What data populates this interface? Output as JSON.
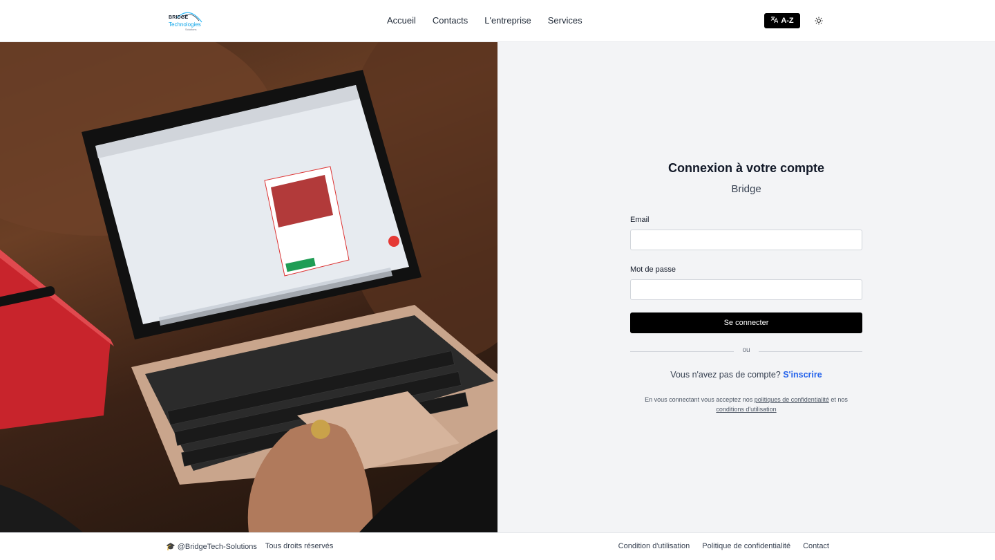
{
  "header": {
    "logo_text": "BRIDGE",
    "logo_sub": "Technologies",
    "logo_tiny": "Solutions",
    "nav": [
      {
        "label": "Accueil"
      },
      {
        "label": "Contacts"
      },
      {
        "label": "L'entreprise"
      },
      {
        "label": "Services"
      }
    ],
    "lang_button": "A-Z",
    "lang_icon": "translate-icon",
    "theme_icon": "sun-icon"
  },
  "hero": {
    "image_icon": "laptop-photo"
  },
  "login": {
    "title": "Connexion à votre compte",
    "subtitle": "Bridge",
    "email_label": "Email",
    "email_value": "",
    "password_label": "Mot de passe",
    "password_value": "",
    "submit_label": "Se connecter",
    "divider_text": "ou",
    "signup_prompt": "Vous n'avez pas de compte?",
    "signup_link": "S'inscrire",
    "legal_prefix": "En vous connectant vous acceptez nos",
    "legal_privacy": "politiques de confidentialité",
    "legal_and": "et nos",
    "legal_terms": "conditions d'utilisation"
  },
  "footer": {
    "handle": "@BridgeTech-Solutions",
    "rights": "Tous droits réservés",
    "links": [
      {
        "label": "Condition d'utilisation"
      },
      {
        "label": "Politique de confidentialité"
      },
      {
        "label": "Contact"
      }
    ],
    "handle_icon": "graduation-cap-icon"
  },
  "colors": {
    "accent_link": "#2563eb",
    "button_bg": "#000000",
    "panel_bg": "#f3f4f6"
  }
}
